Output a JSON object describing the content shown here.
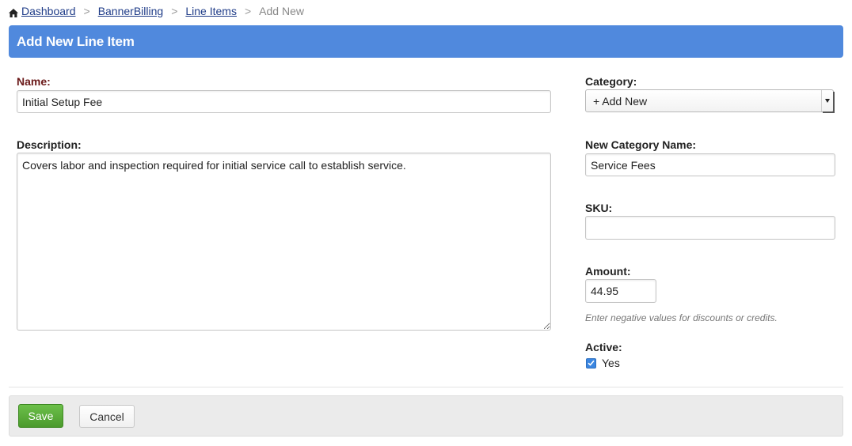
{
  "breadcrumb": {
    "items": [
      {
        "label": "Dashboard"
      },
      {
        "label": "BannerBilling"
      },
      {
        "label": "Line Items"
      }
    ],
    "separator": ">",
    "current": "Add New",
    "home_icon": "home-icon"
  },
  "panel": {
    "title": "Add New Line Item",
    "accent_color": "#5089dd"
  },
  "form": {
    "name": {
      "label": "Name:",
      "value": "Initial Setup Fee"
    },
    "description": {
      "label": "Description:",
      "value": "Covers labor and inspection required for initial service call to establish service."
    },
    "category": {
      "label": "Category:",
      "selected": "+ Add New"
    },
    "new_category_name": {
      "label": "New Category Name:",
      "value": "Service Fees"
    },
    "sku": {
      "label": "SKU:",
      "value": ""
    },
    "amount": {
      "label": "Amount:",
      "value": "44.95",
      "help": "Enter negative values for discounts or credits."
    },
    "active": {
      "label": "Active:",
      "option_label": "Yes",
      "checked": true
    }
  },
  "footer": {
    "save_label": "Save",
    "cancel_label": "Cancel",
    "save_color": "#5aab38"
  }
}
